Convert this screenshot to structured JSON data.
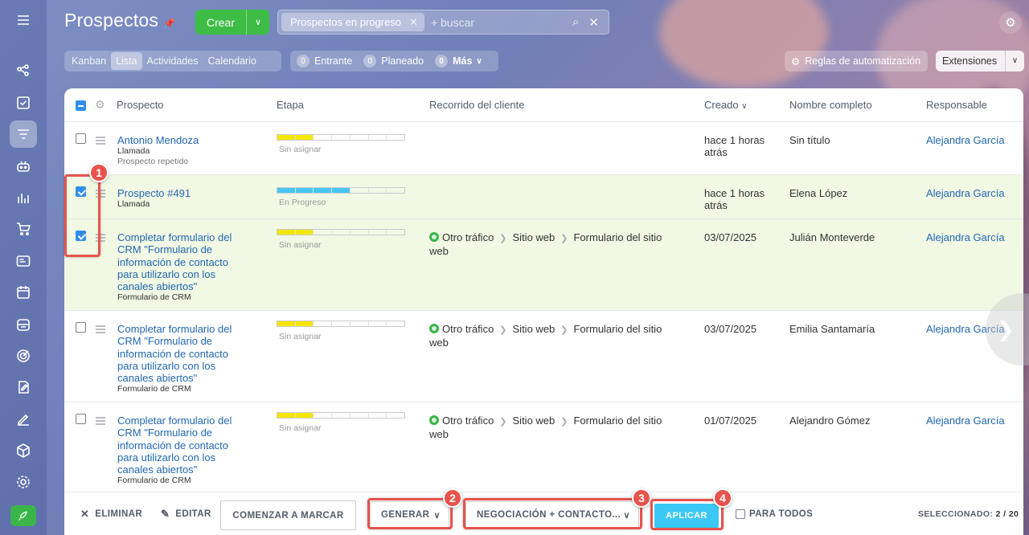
{
  "header": {
    "title": "Prospectos",
    "create_label": "Crear",
    "filter_chip": "Prospectos en progreso",
    "search_placeholder": "+ buscar"
  },
  "view_tabs": [
    {
      "label": "Kanban",
      "active": false
    },
    {
      "label": "Lista",
      "active": true
    },
    {
      "label": "Actividades",
      "active": false
    },
    {
      "label": "Calendario",
      "active": false
    }
  ],
  "counters": [
    {
      "count": "0",
      "label": "Entrante"
    },
    {
      "count": "0",
      "label": "Planeado"
    },
    {
      "count": "0",
      "label": "Más"
    }
  ],
  "toolbar_right": {
    "automation": "Reglas de automatización",
    "extensions": "Extensiones"
  },
  "table": {
    "columns": {
      "prospect": "Prospecto",
      "stage": "Etapa",
      "journey": "Recorrido del cliente",
      "created": "Creado",
      "fullname": "Nombre completo",
      "responsible": "Responsable"
    },
    "rows": [
      {
        "title": "Antonio Mendoza",
        "sub": "Llamada",
        "sub2": "Prospecto repetido",
        "stage_label": "Sin asignar",
        "stage_color": "#f5e600",
        "stage_fill": 0.25,
        "journey": [],
        "journey_tail": "",
        "created_line1": "hace 1 horas",
        "created_line2": "atrás",
        "fullname": "Sin título",
        "responsible": "Alejandra García",
        "checked": false
      },
      {
        "title": "Prospecto #491",
        "sub": "Llamada",
        "sub2": "",
        "stage_label": "En Progreso",
        "stage_color": "#47c6f4",
        "stage_fill": 0.5,
        "journey": [],
        "journey_tail": "",
        "created_line1": "hace 1 horas",
        "created_line2": "atrás",
        "fullname": "Elena López",
        "responsible": "Alejandra García",
        "checked": true
      },
      {
        "title_lines": [
          "Completar formulario del",
          "CRM \"Formulario de",
          "información de contacto",
          "para utilizarlo con los",
          "canales abiertos\""
        ],
        "sub": "Formulario de CRM",
        "stage_label": "Sin asignar",
        "stage_color": "#f5e600",
        "stage_fill": 0.25,
        "journey": [
          "Otro tráfico",
          "Sitio web",
          "Formulario del sitio"
        ],
        "journey_tail": "web",
        "created_line1": "03/07/2025",
        "fullname": "Julián Monteverde",
        "responsible": "Alejandra García",
        "checked": true
      },
      {
        "title_lines": [
          "Completar formulario del",
          "CRM \"Formulario de",
          "información de contacto",
          "para utilizarlo con los",
          "canales abiertos\""
        ],
        "sub": "Formulario de CRM",
        "stage_label": "Sin asignar",
        "stage_color": "#f5e600",
        "stage_fill": 0.25,
        "journey": [
          "Otro tráfico",
          "Sitio web",
          "Formulario del sitio"
        ],
        "journey_tail": "web",
        "created_line1": "03/07/2025",
        "fullname": "Emilia Santamaría",
        "responsible": "Alejandra García",
        "checked": false
      },
      {
        "title_lines": [
          "Completar formulario del",
          "CRM \"Formulario de",
          "información de contacto",
          "para utilizarlo con los",
          "canales abiertos\""
        ],
        "sub": "Formulario de CRM",
        "stage_label": "Sin asignar",
        "stage_color": "#f5e600",
        "stage_fill": 0.25,
        "journey": [
          "Otro tráfico",
          "Sitio web",
          "Formulario del sitio"
        ],
        "journey_tail": "web",
        "created_line1": "01/07/2025",
        "fullname": "Alejandro Gómez",
        "responsible": "Alejandra García",
        "checked": false
      }
    ]
  },
  "bottom_bar": {
    "delete": "ELIMINAR",
    "edit": "EDITAR",
    "start_marking": "COMENZAR A MARCAR",
    "generate": "GENERAR",
    "target": "NEGOCIACIÓN + CONTACTO...",
    "apply": "APLICAR",
    "for_all": "PARA TODOS",
    "selected_label": "SELECCIONADO:",
    "selected_value": "2 / 20"
  },
  "annotations": [
    "1",
    "2",
    "3",
    "4"
  ],
  "colors": {
    "accent_green": "#3ebd46",
    "link_blue": "#2067b0",
    "apply_blue": "#3bc8f5",
    "annotation_red": "#e7534c",
    "selected_row": "#f1f8e4"
  }
}
